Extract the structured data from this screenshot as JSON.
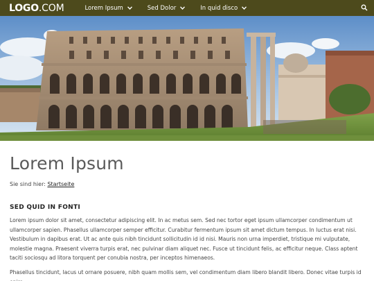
{
  "header": {
    "logo_main": "LOGO",
    "logo_suffix": ".COM",
    "nav": [
      {
        "label": "Lorem Ipsum"
      },
      {
        "label": "Sed Dolor"
      },
      {
        "label": "In quid disco"
      }
    ],
    "search_icon": "search-icon"
  },
  "hero": {
    "image": "photo of the Theatre of Marcellus, Rome"
  },
  "main": {
    "title": "Lorem Ipsum",
    "breadcrumb_prefix": "Sie sind hier:",
    "breadcrumb_link": "Startseite",
    "section_heading": "SED QUID IN FONTI",
    "paragraphs": [
      "Lorem ipsum dolor sit amet, consectetur adipiscing elit. In ac metus sem. Sed nec tortor eget ipsum ullamcorper condimentum ut ullamcorper sapien. Phasellus ullamcorper semper efficitur. Curabitur fermentum ipsum sit amet dictum tempus. In luctus erat nisi. Vestibulum in dapibus erat. Ut ac ante quis nibh tincidunt sollicitudin id id nisi. Mauris non urna imperdiet, tristique mi vulputate, molestie magna. Praesent viverra turpis erat, nec pulvinar diam aliquet nec. Fusce ut tincidunt felis, ac efficitur neque. Class aptent taciti sociosqu ad litora torquent per conubia nostra, per inceptos himenaeos.",
      "Phasellus tincidunt, lacus ut ornare posuere, nibh quam mollis sem, vel condimentum diam libero blandit libero. Donec vitae turpis id enim"
    ]
  },
  "colors": {
    "topbar": "#4d4a1c",
    "title": "#5a5a5a"
  }
}
